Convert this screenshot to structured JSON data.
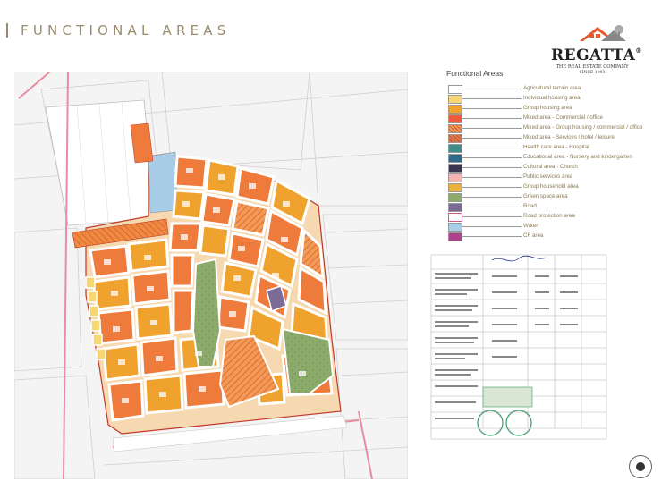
{
  "page": {
    "title": "FUNCTIONAL AREAS"
  },
  "logo": {
    "name": "REGATTA",
    "registered": "®",
    "tagline": "THE REAL ESTATE COMPANY",
    "since": "SINCE 1993"
  },
  "legend": {
    "title": "Functional Areas",
    "items": [
      {
        "label": "Agricultural terrain area",
        "color": "#ffffff",
        "pattern": "plain"
      },
      {
        "label": "Individual housing area",
        "color": "#f7d774",
        "pattern": "plain"
      },
      {
        "label": "Group housing area",
        "color": "#f0a22e",
        "pattern": "plain"
      },
      {
        "label": "Mixed area - Commercial / office",
        "color": "#ee5a3c",
        "pattern": "plain"
      },
      {
        "label": "Mixed area - Group housing / commercial / office",
        "color": "#f29a56",
        "pattern": "hatched"
      },
      {
        "label": "Mixed area - Services / hotel / leisure",
        "color": "#d87a4a",
        "pattern": "hatched"
      },
      {
        "label": "Health care area - Hospital",
        "color": "#3f8e8a",
        "pattern": "plain"
      },
      {
        "label": "Educational area - Nursery and kindergarten",
        "color": "#2f6a88",
        "pattern": "plain"
      },
      {
        "label": "Cultural area - Church",
        "color": "#3a3550",
        "pattern": "plain"
      },
      {
        "label": "Public services area",
        "color": "#f2b4b2",
        "pattern": "plain"
      },
      {
        "label": "Group household area",
        "color": "#e8b13c",
        "pattern": "plain"
      },
      {
        "label": "Green space area",
        "color": "#8cab6a",
        "pattern": "plain"
      },
      {
        "label": "Road",
        "color": "#7c6b96",
        "pattern": "plain"
      },
      {
        "label": "Road protection area",
        "color": "#d65a7c",
        "pattern": "outline"
      },
      {
        "label": "Water",
        "color": "#a7cde8",
        "pattern": "plain"
      },
      {
        "label": "CF area",
        "color": "#b0418f",
        "pattern": "plain"
      }
    ]
  },
  "colors": {
    "title": "#9a8d6e",
    "legend_text": "#8a7a55",
    "housing": "#f0a22e",
    "mixed": "#ee7a3c",
    "green": "#8cab6a",
    "road": "#ffffff",
    "road_protection": "#e88da0"
  },
  "icons": {
    "nav_button": "compass-button-icon",
    "logo_roof": "house-roof-icon"
  }
}
